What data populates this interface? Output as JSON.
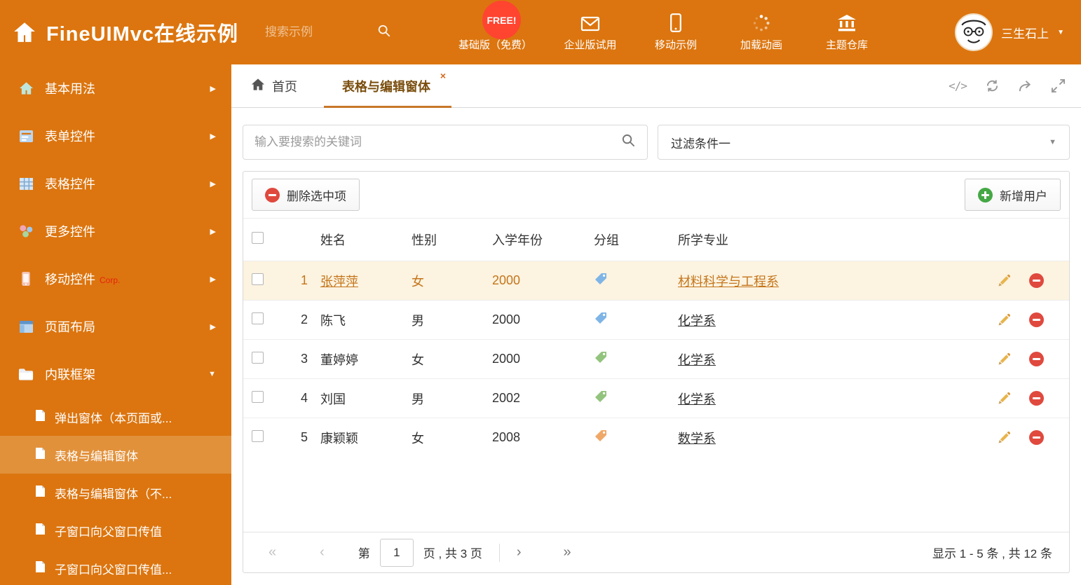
{
  "header": {
    "title": "FineUIMvc在线示例",
    "search_placeholder": "搜索示例",
    "free_badge": "FREE!",
    "nav": [
      {
        "label": "基础版（免费）",
        "icon": "download-icon"
      },
      {
        "label": "企业版试用",
        "icon": "mail-icon"
      },
      {
        "label": "移动示例",
        "icon": "mobile-icon"
      },
      {
        "label": "加载动画",
        "icon": "spinner-icon"
      },
      {
        "label": "主题仓库",
        "icon": "bank-icon"
      }
    ],
    "user_name": "三生石上"
  },
  "sidebar": {
    "items": [
      {
        "label": "基本用法",
        "icon": "home-icon"
      },
      {
        "label": "表单控件",
        "icon": "form-icon"
      },
      {
        "label": "表格控件",
        "icon": "grid-icon"
      },
      {
        "label": "更多控件",
        "icon": "widgets-icon"
      },
      {
        "label": "移动控件",
        "badge": "Corp.",
        "icon": "phone-icon"
      },
      {
        "label": "页面布局",
        "icon": "layout-icon"
      },
      {
        "label": "内联框架",
        "icon": "frame-icon"
      }
    ],
    "subitems": [
      {
        "label": "弹出窗体（本页面或..."
      },
      {
        "label": "表格与编辑窗体",
        "selected": true
      },
      {
        "label": "表格与编辑窗体（不..."
      },
      {
        "label": "子窗口向父窗口传值"
      },
      {
        "label": "子窗口向父窗口传值..."
      }
    ]
  },
  "tabs": {
    "home": "首页",
    "active": "表格与编辑窗体"
  },
  "filters": {
    "search_placeholder": "输入要搜索的关键词",
    "filter_value": "过滤条件一"
  },
  "toolbar": {
    "delete_label": "删除选中项",
    "add_label": "新增用户"
  },
  "table": {
    "headers": {
      "name": "姓名",
      "gender": "性别",
      "year": "入学年份",
      "group": "分组",
      "major": "所学专业"
    },
    "rows": [
      {
        "num": "1",
        "name": "张萍萍",
        "gender": "女",
        "year": "2000",
        "tag": "blue",
        "major": "材料科学与工程系",
        "selected": true
      },
      {
        "num": "2",
        "name": "陈飞",
        "gender": "男",
        "year": "2000",
        "tag": "blue",
        "major": "化学系"
      },
      {
        "num": "3",
        "name": "董婷婷",
        "gender": "女",
        "year": "2000",
        "tag": "green",
        "major": "化学系"
      },
      {
        "num": "4",
        "name": "刘国",
        "gender": "男",
        "year": "2002",
        "tag": "green",
        "major": "化学系"
      },
      {
        "num": "5",
        "name": "康颖颖",
        "gender": "女",
        "year": "2008",
        "tag": "orange",
        "major": "数学系"
      }
    ]
  },
  "pagination": {
    "label_page": "第",
    "current_page": "1",
    "label_total": "页 , 共 3 页",
    "summary": "显示 1 - 5 条 , 共 12 条"
  },
  "icons": {
    "close": "×",
    "code": "</>",
    "chevron_right": "▶",
    "chevron_down": "▼",
    "caret_down": "▼",
    "angle_double_left": "«",
    "angle_left": "‹",
    "angle_right": "›",
    "angle_double_right": "»"
  },
  "colors": {
    "primary_orange": "#DC750F",
    "selected_item_orange": "#E2913B",
    "active_tab_underline": "#C8772A",
    "row_highlight_bg": "#FCF3E0",
    "row_highlight_text": "#C4751B",
    "free_badge_red": "#FF4430",
    "delete_red": "#E0493E",
    "add_green": "#45A845"
  }
}
